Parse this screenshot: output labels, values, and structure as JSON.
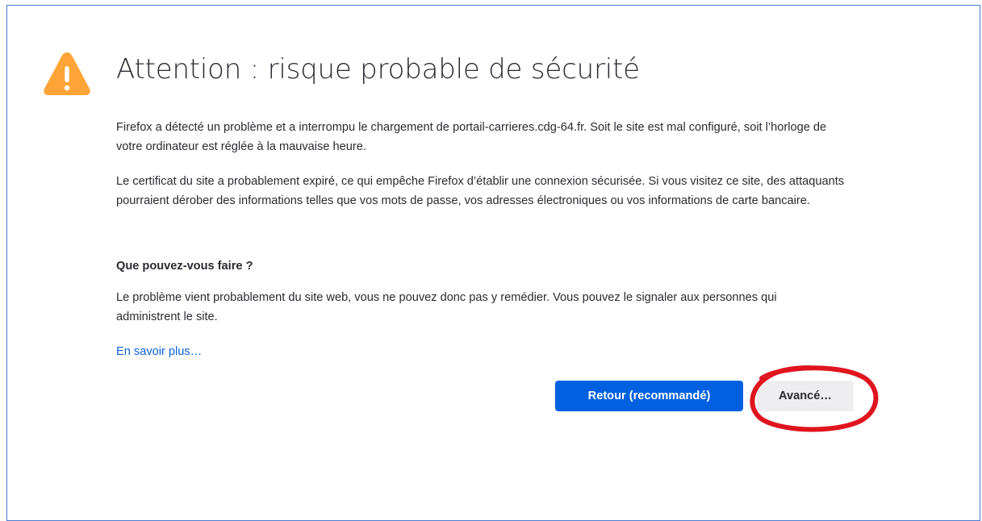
{
  "error_page": {
    "title": "Attention : risque probable de sécurité",
    "paragraph1": "Firefox a détecté un problème et a interrompu le chargement de portail-carrieres.cdg-64.fr. Soit le site est mal configuré, soit l’horloge de votre ordinateur est réglée à la mauvaise heure.",
    "paragraph2": "Le certificat du site a probablement expiré, ce qui empêche Firefox d’établir une connexion sécurisée. Si vous visitez ce site, des attaquants pourraient dérober des informations telles que vos mots de passe, vos adresses électroniques ou vos informations de carte bancaire.",
    "what_can_you_do_heading": "Que pouvez-vous faire ?",
    "paragraph3": "Le problème vient probablement du site web, vous ne pouvez donc pas y remédier. Vous pouvez le signaler aux personnes qui administrent le site.",
    "learn_more_link": "En savoir plus…",
    "back_button_label": "Retour (recommandé)",
    "advanced_button_label": "Avancé…"
  },
  "icons": {
    "warning": "warning-triangle-icon",
    "annotation": "red-ellipse-annotation"
  },
  "colors": {
    "frame_border": "#4a7bd0",
    "warning_icon": "#ffa436",
    "primary_button": "#0061e0",
    "secondary_button": "#eeeef1",
    "link": "#0a63d9",
    "annotation": "#e0141e",
    "text": "#2b2a33"
  }
}
